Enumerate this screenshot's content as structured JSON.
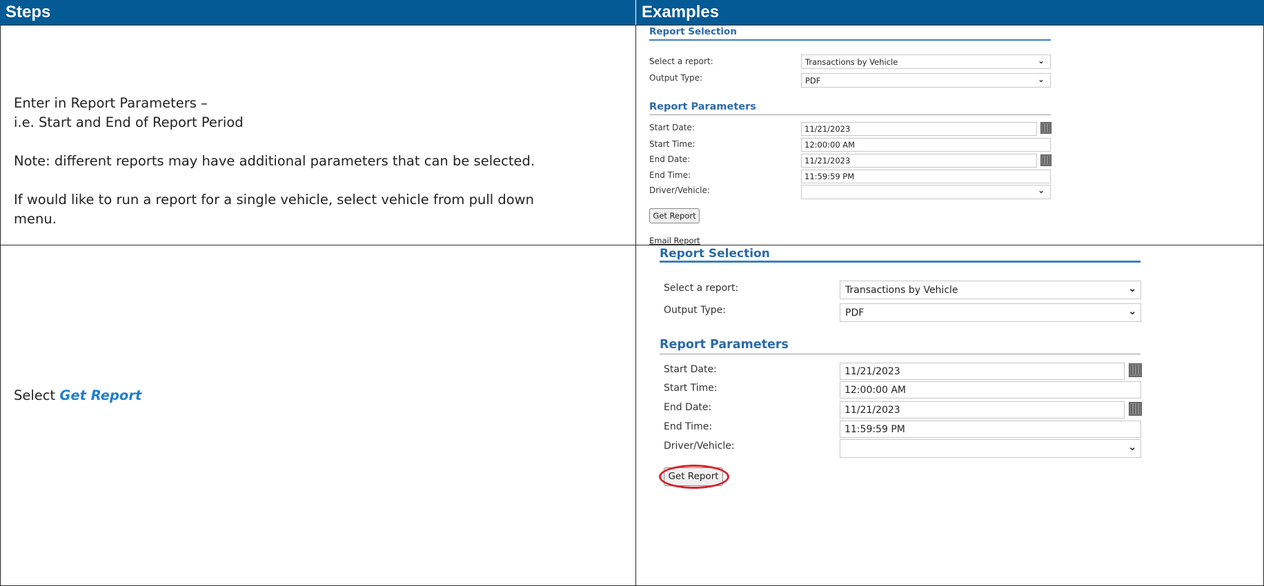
{
  "table": {
    "header_steps": "Steps",
    "header_examples": "Examples"
  },
  "row1": {
    "line1": "Enter in Report Parameters –",
    "line2": "i.e. Start and End of Report Period",
    "note": "Note: different reports may have additional parameters that can be selected.",
    "single_vehicle_line1": "If would like to run a report for a single vehicle, select vehicle from pull down",
    "single_vehicle_line2": "menu."
  },
  "row2": {
    "select_prefix": "Select ",
    "select_link": "Get Report"
  },
  "report_form": {
    "section_selection": "Report Selection",
    "select_report_label": "Select a report:",
    "select_report_value": "Transactions by Vehicle",
    "output_type_label": "Output Type:",
    "output_type_value": "PDF",
    "section_parameters": "Report Parameters",
    "start_date_label": "Start Date:",
    "start_date_value": "11/21/2023",
    "start_time_label": "Start Time:",
    "start_time_value": "12:00:00 AM",
    "end_date_label": "End Date:",
    "end_date_value": "11/21/2023",
    "end_time_label": "End Time:",
    "end_time_value": "11:59:59 PM",
    "driver_vehicle_label": "Driver/Vehicle:",
    "driver_vehicle_value": "",
    "get_report_button": "Get Report",
    "email_report_link": "Email Report"
  },
  "icons": {
    "dropdown": "chevron-down-icon",
    "calendar": "calendar-icon"
  },
  "colors": {
    "header_bg": "#035a94",
    "section_title": "#2a6aa8",
    "link_text": "#1f7fc8",
    "highlight_ring": "#d2242b"
  }
}
